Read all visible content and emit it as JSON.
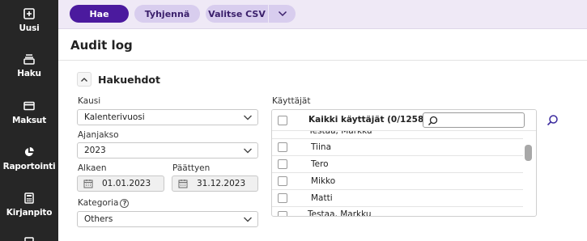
{
  "sidebar": {
    "items": [
      {
        "label": "Uusi",
        "icon": "plus-square-icon"
      },
      {
        "label": "Haku",
        "icon": "inbox-stack-icon"
      },
      {
        "label": "Maksut",
        "icon": "credit-card-icon"
      },
      {
        "label": "Raportointi",
        "icon": "pie-chart-icon"
      },
      {
        "label": "Kirjanpito",
        "icon": "calculator-icon"
      }
    ]
  },
  "toolbar": {
    "search_label": "Hae",
    "clear_label": "Tyhjennä",
    "csv_label": "Valitse CSV"
  },
  "page": {
    "title": "Audit log"
  },
  "filters": {
    "section_title": "Hakuehdot",
    "period_label": "Kausi",
    "period_value": "Kalenterivuosi",
    "year_label": "Ajanjakso",
    "year_value": "2023",
    "start_label": "Alkaen",
    "start_value": "01.01.2023",
    "end_label": "Päättyen",
    "end_value": "31.12.2023",
    "category_label": "Kategoria",
    "category_value": "Others"
  },
  "users": {
    "label": "Käyttäjät",
    "header": "Kaikki käyttäjät (0/1258)",
    "search_value": "",
    "top_partial": "Testaa, Markku",
    "rows": [
      "Tiina",
      "Tero",
      "Mikko",
      "Matti"
    ],
    "bottom_partial": "Testaa, Markku"
  },
  "colors": {
    "sidebar_bg": "#262626",
    "toolbar_bg": "#efe9f6",
    "primary": "#4b1a9e",
    "secondary": "#d8cdee"
  }
}
